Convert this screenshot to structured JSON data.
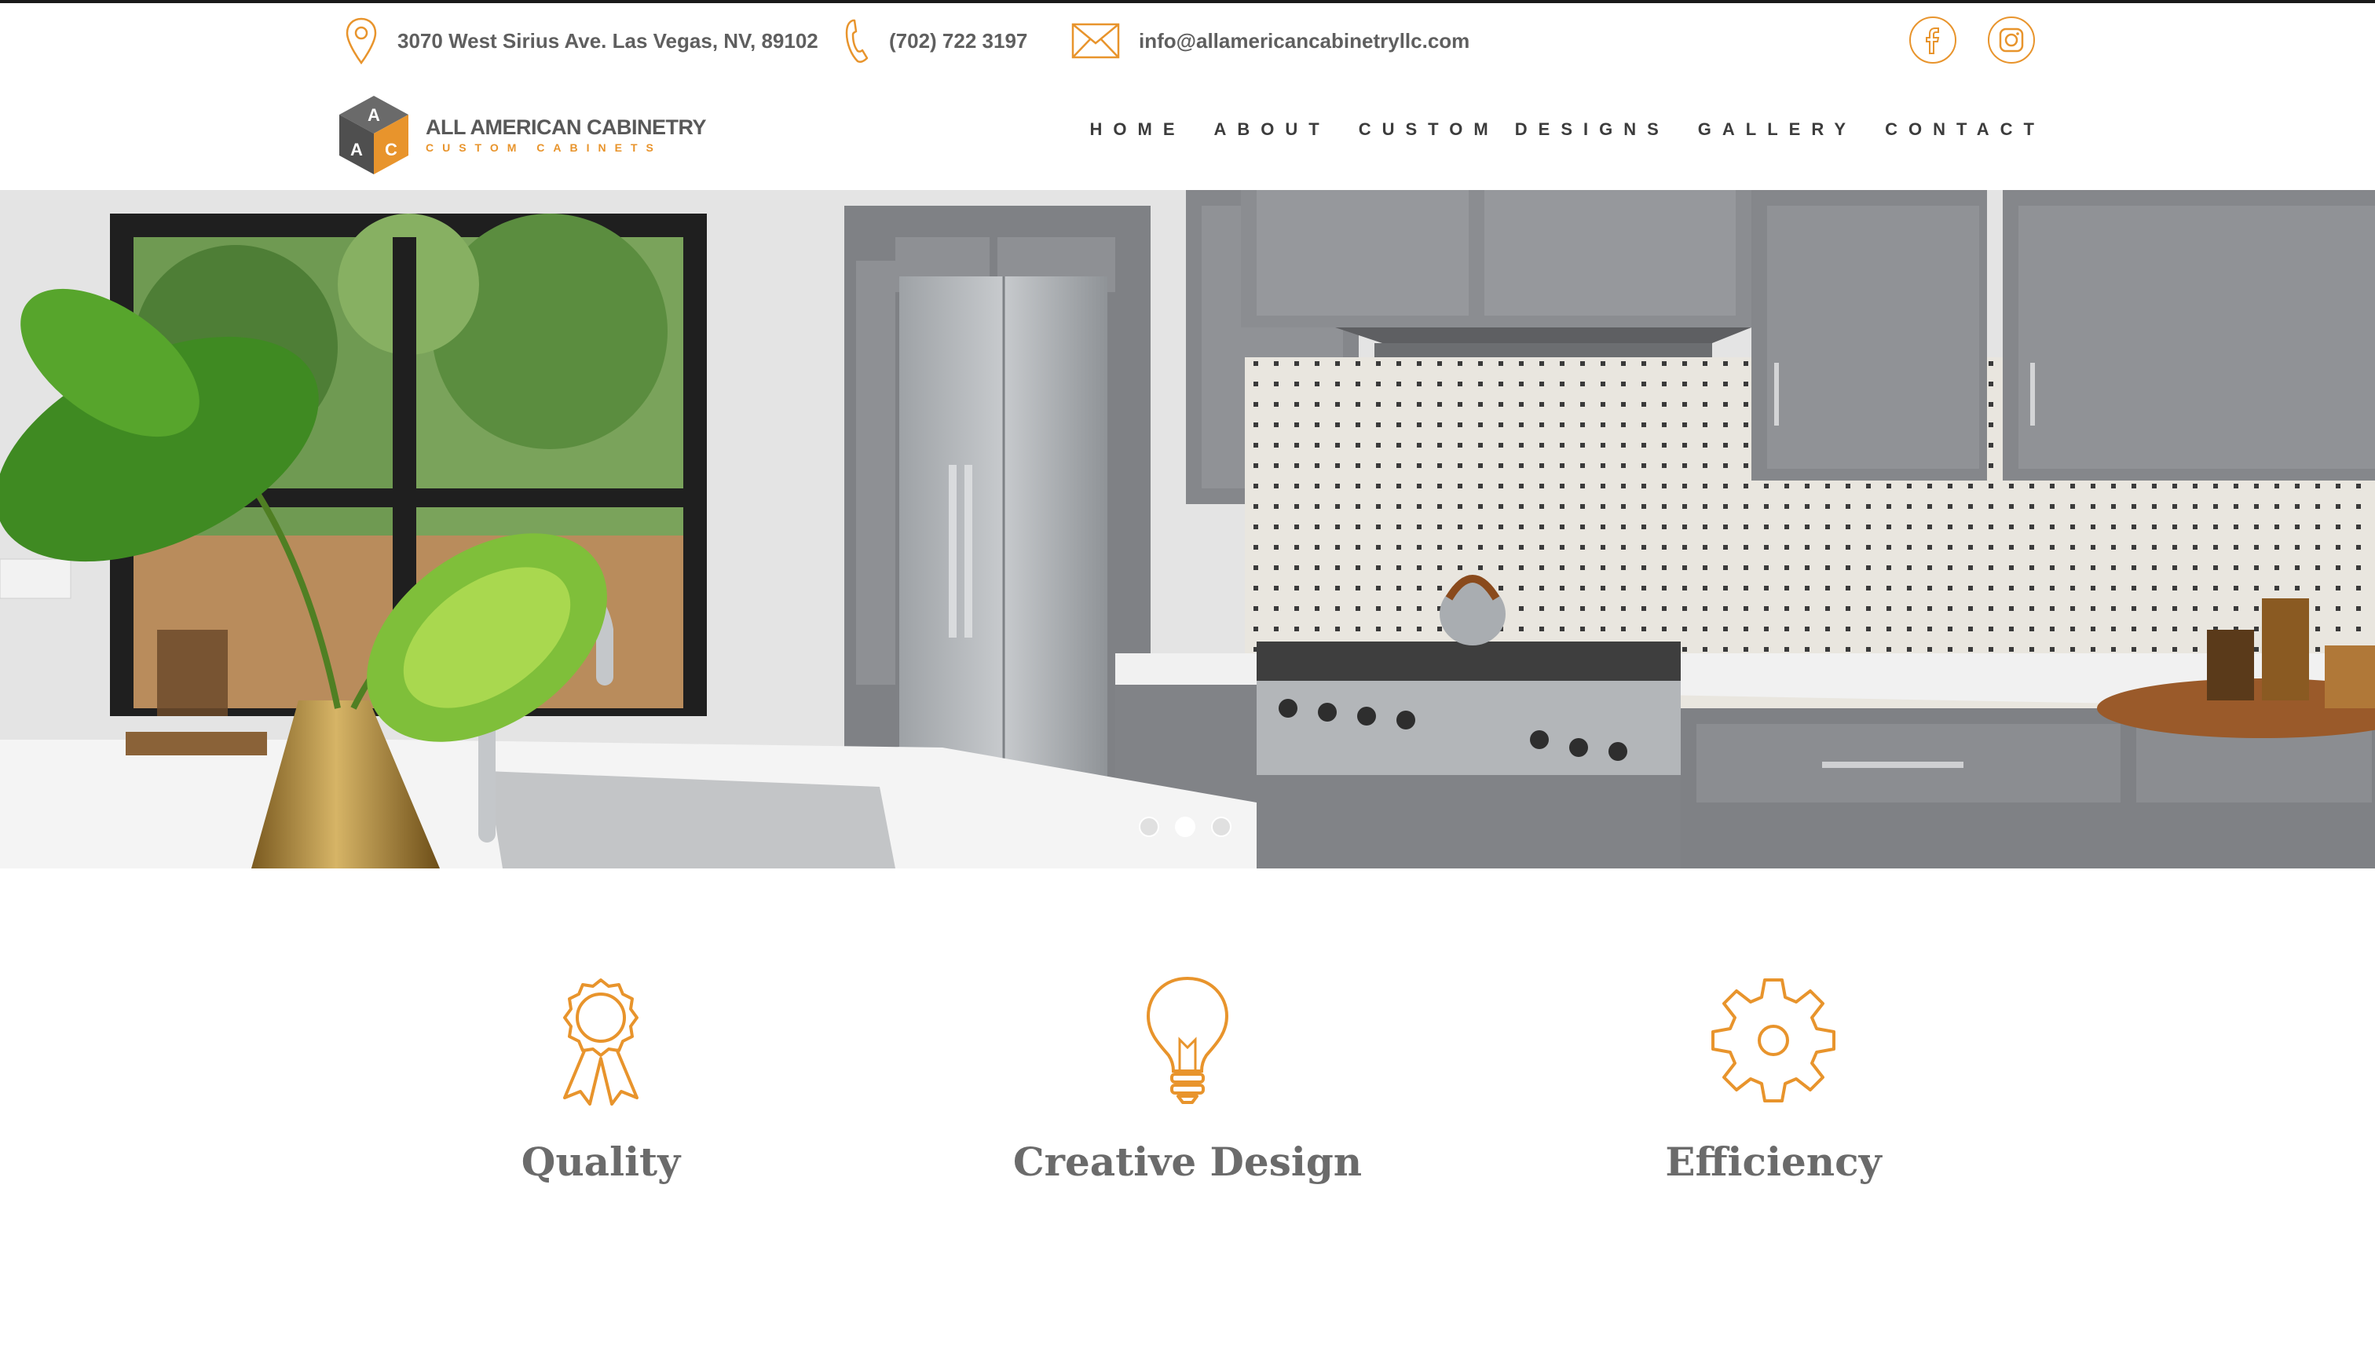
{
  "contact": {
    "address": "3070 West Sirius Ave. Las Vegas, NV, 89102",
    "phone": "(702) 722 3197",
    "email": "info@allamericancabinetryllc.com"
  },
  "social": {
    "facebook_icon": "facebook-icon",
    "instagram_icon": "instagram-icon"
  },
  "brand": {
    "name": "ALL AMERICAN CABINETRY",
    "tagline": "CUSTOM CABINETS"
  },
  "nav": {
    "items": [
      "HOME",
      "ABOUT",
      "CUSTOM DESIGNS",
      "GALLERY",
      "CONTACT"
    ]
  },
  "slider": {
    "slide_count": 3,
    "active_slide": 2
  },
  "features": [
    {
      "title": "Quality",
      "icon": "award-ribbon-icon"
    },
    {
      "title": "Creative Design",
      "icon": "lightbulb-icon"
    },
    {
      "title": "Efficiency",
      "icon": "gear-icon"
    }
  ],
  "colors": {
    "accent": "#e8942c",
    "text": "#5f5f5f",
    "cabinet_gray": "#8a8c8f"
  }
}
